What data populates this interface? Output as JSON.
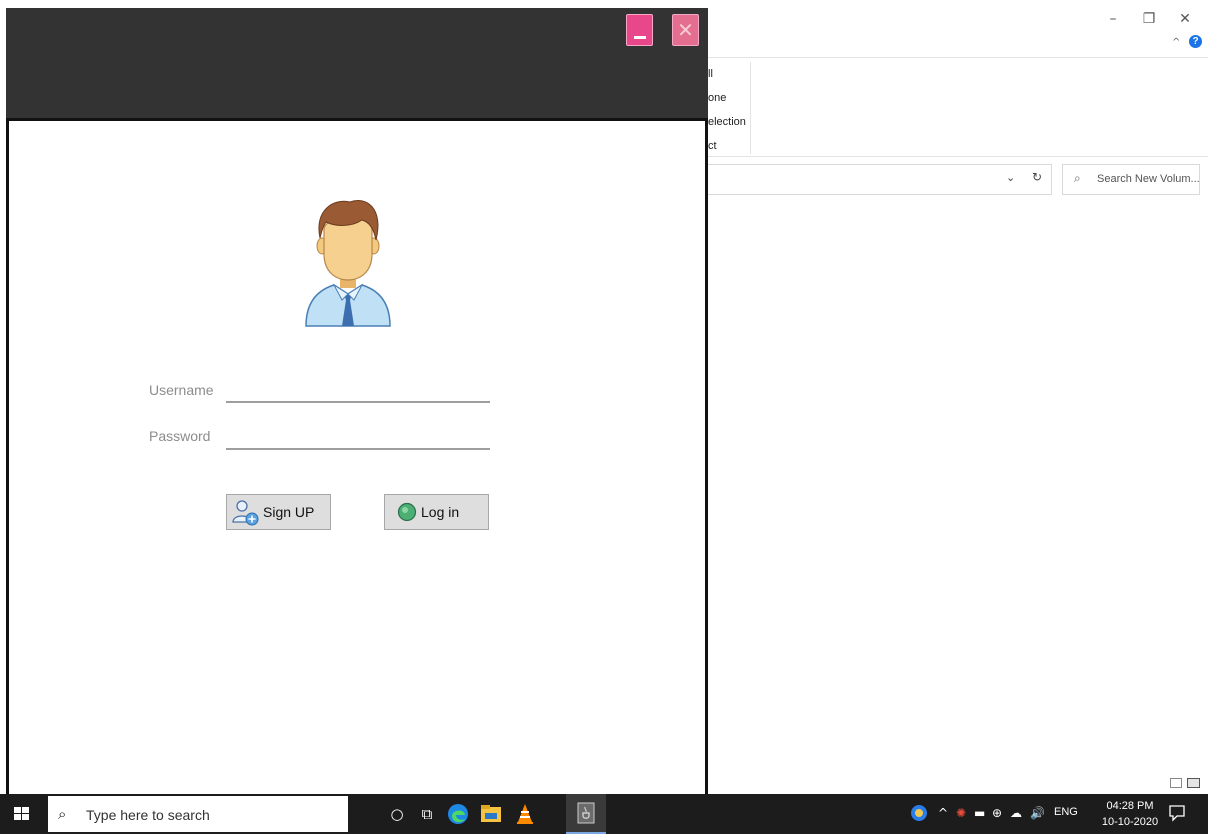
{
  "explorer": {
    "minimize_glyph": "–",
    "maximize_glyph": "❐",
    "close_glyph": "✕",
    "collapse_glyph": "^",
    "help_glyph": "?",
    "ribbon": {
      "line1": "ll",
      "line2": "one",
      "line3": "election",
      "line4": "ct"
    },
    "address_dropdown_glyph": "⌄",
    "refresh_glyph": "↻",
    "search_placeholder": "Search New Volum..."
  },
  "login_app": {
    "username_label": "Username",
    "password_label": "Password",
    "username_value": "",
    "password_value": "",
    "signup_label": "Sign UP",
    "login_label": "Log in",
    "close_glyph": "✕"
  },
  "taskbar": {
    "search_placeholder": "Type here to search",
    "cortana_glyph": "○",
    "taskview_glyph": "⧉",
    "tray": {
      "chevron": "^",
      "volume_glyph": "🔊",
      "language": "ENG",
      "time": "04:28 PM",
      "date": "10-10-2020"
    }
  },
  "colors": {
    "titlebar": "#333333",
    "minimize_btn": "#e8478b",
    "close_btn": "#e46e8f",
    "taskbar": "#1c1c1c",
    "accent_blue": "#1a73e8"
  }
}
